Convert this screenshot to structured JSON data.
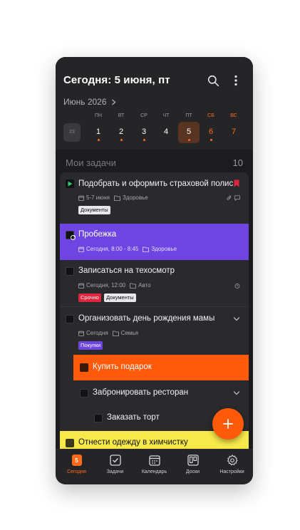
{
  "header": {
    "title": "Сегодня: 5 июня, пт",
    "month_label": "Июнь 2026"
  },
  "calendar": {
    "weekdays": [
      "ПН",
      "ВТ",
      "СР",
      "ЧТ",
      "ПТ",
      "СБ",
      "ВС"
    ],
    "prev_day": "23",
    "days": [
      "1",
      "2",
      "3",
      "4",
      "5",
      "6",
      "7"
    ],
    "selected_day": "5",
    "days_with_tasks": [
      "1",
      "2",
      "3",
      "5",
      "6"
    ]
  },
  "section": {
    "title": "Мои задачи",
    "count": "10"
  },
  "tasks": [
    {
      "title": "Подобрать и оформить страховой полис",
      "date": "5-7 июня",
      "folder": "Здоровье",
      "tags": [
        "Документы"
      ]
    },
    {
      "title": "Пробежка",
      "date": "Сегодня, 8:00 - 8:45",
      "folder": "Здоровье",
      "tags": []
    },
    {
      "title": "Записаться на техосмотр",
      "date": "Сегодня, 12:00",
      "folder": "Авто",
      "tags": [
        "Срочно",
        "Документы"
      ]
    },
    {
      "title": "Организовать день рождения мамы",
      "date": "Сегодня",
      "folder": "Семья",
      "tags": [
        "Покупки"
      ]
    },
    {
      "title": "Купить подарок",
      "date": "",
      "folder": "",
      "tags": []
    },
    {
      "title": "Забронировать ресторан",
      "date": "",
      "folder": "",
      "tags": []
    },
    {
      "title": "Заказать торт",
      "date": "",
      "folder": "",
      "tags": []
    },
    {
      "title": "Отнести одежду в химчистку",
      "date": "",
      "folder": "",
      "tags": []
    }
  ],
  "nav": {
    "items": [
      {
        "label": "Сегодня",
        "icon": "today-icon",
        "badge": "5",
        "active": true
      },
      {
        "label": "Задачи",
        "icon": "tasks-icon",
        "active": false
      },
      {
        "label": "Календарь",
        "icon": "calendar-icon",
        "active": false
      },
      {
        "label": "Доски",
        "icon": "boards-icon",
        "active": false
      },
      {
        "label": "Настройки",
        "icon": "settings-icon",
        "active": false
      }
    ]
  },
  "colors": {
    "accent": "#ff6a1a",
    "fab": "#ff5a0a",
    "running_task": "#6e45e2",
    "gift_task": "#ff5a0a",
    "laundry_task": "#f7e94a",
    "tag_urgent": "#e0263f",
    "tag_purchases": "#6e45e2",
    "tag_documents": "#e8e8ec"
  }
}
